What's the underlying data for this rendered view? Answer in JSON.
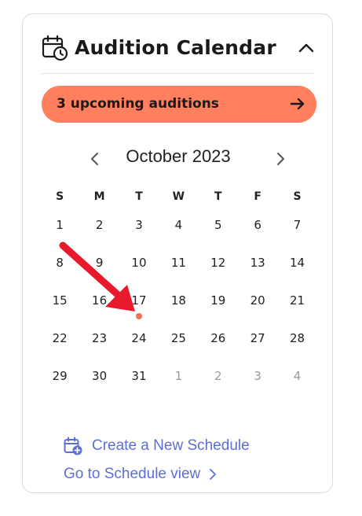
{
  "widget": {
    "title": "Audition Calendar",
    "banner_text": "3 upcoming auditions",
    "month_label": "October 2023",
    "weekdays": [
      "S",
      "M",
      "T",
      "W",
      "T",
      "F",
      "S"
    ],
    "weeks": [
      [
        {
          "d": "1"
        },
        {
          "d": "2"
        },
        {
          "d": "3"
        },
        {
          "d": "4"
        },
        {
          "d": "5"
        },
        {
          "d": "6"
        },
        {
          "d": "7"
        }
      ],
      [
        {
          "d": "8"
        },
        {
          "d": "9"
        },
        {
          "d": "10"
        },
        {
          "d": "11"
        },
        {
          "d": "12"
        },
        {
          "d": "13"
        },
        {
          "d": "14"
        }
      ],
      [
        {
          "d": "15"
        },
        {
          "d": "16"
        },
        {
          "d": "17",
          "event": true
        },
        {
          "d": "18"
        },
        {
          "d": "19"
        },
        {
          "d": "20"
        },
        {
          "d": "21"
        }
      ],
      [
        {
          "d": "22"
        },
        {
          "d": "23"
        },
        {
          "d": "24"
        },
        {
          "d": "25"
        },
        {
          "d": "26"
        },
        {
          "d": "27"
        },
        {
          "d": "28"
        }
      ],
      [
        {
          "d": "29"
        },
        {
          "d": "30"
        },
        {
          "d": "31"
        },
        {
          "d": "1",
          "muted": true
        },
        {
          "d": "2",
          "muted": true
        },
        {
          "d": "3",
          "muted": true
        },
        {
          "d": "4",
          "muted": true
        }
      ]
    ],
    "create_link": "Create a New Schedule",
    "schedule_link": "Go to Schedule view"
  },
  "colors": {
    "accent": "#ff7f5f",
    "event_dot": "#f07155",
    "link": "#5c6fd6",
    "annotation_arrow": "#e8192c"
  },
  "icons": {
    "title_icon": "calendar-clock-icon",
    "collapse": "chevron-up-icon",
    "banner": "arrow-right-icon",
    "prev": "chevron-left-icon",
    "next": "chevron-right-icon",
    "create": "calendar-plus-icon",
    "schedule": "chevron-right-icon"
  }
}
